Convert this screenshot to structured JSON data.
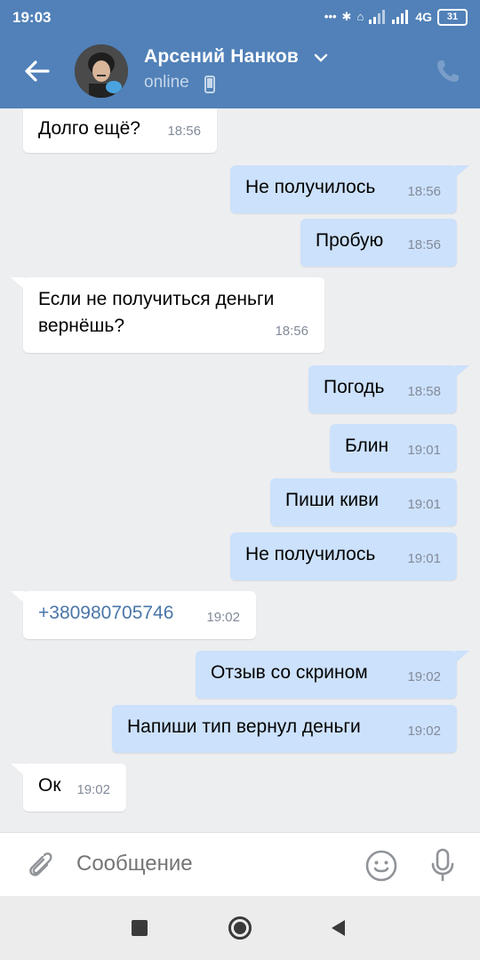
{
  "status_bar": {
    "time": "19:03",
    "signal_label": "4G",
    "battery": "31"
  },
  "header": {
    "contact_name": "Арсений Нанков",
    "status": "online",
    "colors": {
      "bar": "#5181b8",
      "status_text": "#c5d6ea"
    }
  },
  "messages": [
    {
      "direction": "in",
      "text": "Долго ещё?",
      "time": "18:56"
    },
    {
      "direction": "out",
      "text": "Не получилось",
      "time": "18:56"
    },
    {
      "direction": "out",
      "text": "Пробую",
      "time": "18:56"
    },
    {
      "direction": "in",
      "text": "Если не получиться деньги вернёшь?",
      "time": "18:56"
    },
    {
      "direction": "out",
      "text": "Погодь",
      "time": "18:58"
    },
    {
      "direction": "out",
      "text": "Блин",
      "time": "19:01"
    },
    {
      "direction": "out",
      "text": "Пиши киви",
      "time": "19:01"
    },
    {
      "direction": "out",
      "text": "Не получилось",
      "time": "19:01"
    },
    {
      "direction": "in",
      "text": "+380980705746",
      "time": "19:02",
      "is_link": true
    },
    {
      "direction": "out",
      "text": "Отзыв со скрином",
      "time": "19:02"
    },
    {
      "direction": "out",
      "text": "Напиши тип вернул деньги",
      "time": "19:02"
    },
    {
      "direction": "in",
      "text": "Ок",
      "time": "19:02"
    }
  ],
  "composer": {
    "placeholder": "Сообщение",
    "icons": [
      "paperclip-icon",
      "emoji-icon",
      "microphone-icon"
    ]
  },
  "nav": {
    "icons": [
      "recents-square-icon",
      "home-circle-icon",
      "back-triangle-icon"
    ]
  },
  "colors": {
    "incoming_bubble": "#ffffff",
    "outgoing_bubble": "#cce1fb",
    "background": "#edeef0",
    "link": "#4a76a8",
    "time": "#828a99"
  }
}
